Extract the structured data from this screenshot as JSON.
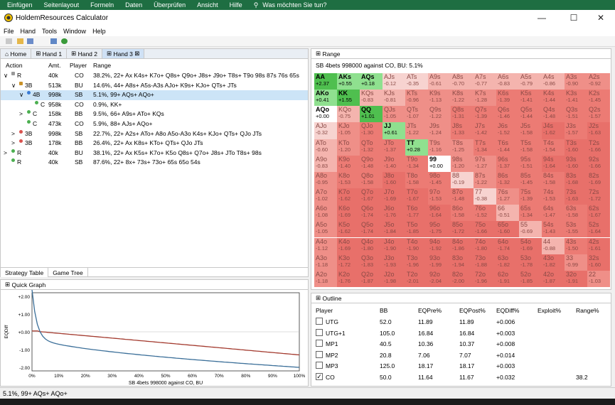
{
  "excel_menu": [
    "Einfügen",
    "Seitenlayout",
    "Formeln",
    "Daten",
    "Überprüfen",
    "Ansicht",
    "Hilfe",
    "Was möchten Sie tun?"
  ],
  "window": {
    "title": "HoldemResources Calculator",
    "min": "—",
    "max": "☐",
    "close": "✕"
  },
  "menu": [
    "File",
    "Hand",
    "Tools",
    "Window",
    "Help"
  ],
  "left_tabs": [
    "Home",
    "Hand 1",
    "Hand 2",
    "Hand 3"
  ],
  "tree": {
    "headers": [
      "Action",
      "Amt.",
      "Player",
      "Range"
    ],
    "rows": [
      {
        "indent": 0,
        "tog": "∨",
        "icon": "fold",
        "action": "R",
        "amt": "40k",
        "player": "CO",
        "range": "38.2%, 22+ Ax K4s+ K7o+ Q8s+ Q9o+ J8s+ J9o+ T8s+ T9o 98s 87s 76s 65s"
      },
      {
        "indent": 1,
        "tog": "∨",
        "icon": "lock",
        "action": "3B",
        "amt": "513k",
        "player": "BU",
        "range": "14.6%, 44+ A8s+ A5s-A3s AJo+ K9s+ KJo+ QTs+ JTs"
      },
      {
        "indent": 2,
        "tog": "∨",
        "icon": "blue",
        "action": "4B",
        "amt": "998k",
        "player": "SB",
        "range": "5.1%, 99+ AQs+ AQo+",
        "sel": true
      },
      {
        "indent": 3,
        "tog": "",
        "icon": "green",
        "action": "C",
        "amt": "958k",
        "player": "CO",
        "range": "0.9%, KK+"
      },
      {
        "indent": 2,
        "tog": ">",
        "icon": "green",
        "action": "C",
        "amt": "158k",
        "player": "BB",
        "range": "9.5%, 66+ A9s+ ATo+ KQs"
      },
      {
        "indent": 2,
        "tog": "",
        "icon": "green",
        "action": "C",
        "amt": "473k",
        "player": "CO",
        "range": "5.9%, 88+ AJs+ AQo+"
      },
      {
        "indent": 1,
        "tog": ">",
        "icon": "red",
        "action": "3B",
        "amt": "998k",
        "player": "SB",
        "range": "22.7%, 22+ A2s+ ATo+ A8o A5o-A3o K4s+ KJo+ QTs+ QJo JTs"
      },
      {
        "indent": 1,
        "tog": ">",
        "icon": "red",
        "action": "3B",
        "amt": "178k",
        "player": "BB",
        "range": "26.4%, 22+ Ax K8s+ KTo+ QTs+ QJo JTs"
      },
      {
        "indent": 0,
        "tog": ">",
        "icon": "green",
        "action": "R",
        "amt": "40k",
        "player": "BU",
        "range": "38.1%, 22+ Ax K5s+ K7o+ K5o Q8s+ Q7o+ J8s+ JTo T8s+ 98s"
      },
      {
        "indent": 0,
        "tog": "",
        "icon": "green",
        "action": "R",
        "amt": "40k",
        "player": "SB",
        "range": "87.6%, 22+ 8x+ 73s+ 73o+ 65s 65o 54s"
      }
    ]
  },
  "bottom_tabs": [
    "Strategy Table",
    "Game Tree"
  ],
  "range_panel": {
    "title": "Range",
    "info": "SB 4bets 998000 against CO, BU: 5.1%"
  },
  "grid": [
    [
      "AA",
      "+2.37",
      "AKs",
      "+0.55",
      "AQs",
      "+0.18",
      "AJs",
      "-0.12",
      "ATs",
      "-0.35",
      "A9s",
      "-0.61",
      "A8s",
      "-0.70",
      "A7s",
      "-0.77",
      "A6s",
      "-0.83",
      "A5s",
      "-0.79",
      "A4s",
      "-0.86",
      "A3s",
      "-0.90",
      "A2s",
      "-0.92"
    ],
    [
      "AKo",
      "+0.41",
      "KK",
      "+1.55",
      "KQs",
      "-0.83",
      "KJs",
      "-0.81",
      "KTs",
      "-0.96",
      "K9s",
      "-1.13",
      "K8s",
      "-1.22",
      "K7s",
      "-1.28",
      "K6s",
      "-1.39",
      "K5s",
      "-1.41",
      "K4s",
      "-1.44",
      "K3s",
      "-1.41",
      "K2s",
      "-1.45"
    ],
    [
      "AQo",
      "+0.00",
      "KQo",
      "-0.75",
      "QQ",
      "+1.01",
      "QJs",
      "-1.05",
      "QTs",
      "-1.07",
      "Q9s",
      "-1.22",
      "Q8s",
      "-1.31",
      "Q7s",
      "-1.39",
      "Q6s",
      "-1.46",
      "Q5s",
      "-1.44",
      "Q4s",
      "-1.48",
      "Q3s",
      "-1.51",
      "Q2s",
      "-1.57"
    ],
    [
      "AJo",
      "-0.32",
      "KJo",
      "-1.05",
      "QJo",
      "-1.30",
      "JJ",
      "+0.61",
      "JTs",
      "-1.22",
      "J9s",
      "-1.24",
      "J8s",
      "-1.33",
      "J7s",
      "-1.42",
      "J6s",
      "-1.52",
      "J5s",
      "-1.58",
      "J4s",
      "-1.62",
      "J3s",
      "-1.57",
      "J2s",
      "-1.63"
    ],
    [
      "ATo",
      "-0.60",
      "KTo",
      "-1.20",
      "QTo",
      "-1.32",
      "JTo",
      "-1.37",
      "TT",
      "+0.28",
      "T9s",
      "-1.16",
      "T8s",
      "-1.25",
      "T7s",
      "-1.34",
      "T6s",
      "-1.44",
      "T5s",
      "-1.58",
      "T4s",
      "-1.54",
      "T3s",
      "-1.60",
      "T2s",
      "-1.66"
    ],
    [
      "A9o",
      "-0.83",
      "K9o",
      "-1.40",
      "Q9o",
      "-1.48",
      "J9o",
      "-1.40",
      "T9o",
      "-1.34",
      "99",
      "+0.00",
      "98s",
      "-1.20",
      "97s",
      "-1.27",
      "96s",
      "-1.37",
      "95s",
      "-1.51",
      "94s",
      "-1.64",
      "93s",
      "-1.60",
      "92s",
      "-1.66"
    ],
    [
      "A8o",
      "-0.95",
      "K8o",
      "-1.53",
      "Q8o",
      "-1.58",
      "J8o",
      "-1.60",
      "T8o",
      "-1.58",
      "98o",
      "-1.45",
      "88",
      "-0.19",
      "87s",
      "-1.22",
      "86s",
      "-1.32",
      "85s",
      "-1.45",
      "84s",
      "-1.58",
      "83s",
      "-1.68",
      "82s",
      "-1.69"
    ],
    [
      "A7o",
      "-1.02",
      "K7o",
      "-1.62",
      "Q7o",
      "-1.67",
      "J7o",
      "-1.69",
      "T7o",
      "-1.67",
      "97o",
      "-1.53",
      "87o",
      "-1.48",
      "77",
      "-0.38",
      "76s",
      "-1.27",
      "75s",
      "-1.39",
      "74s",
      "-1.53",
      "73s",
      "-1.63",
      "72s",
      "-1.72"
    ],
    [
      "A6o",
      "-1.08",
      "K6o",
      "-1.69",
      "Q6o",
      "-1.74",
      "J6o",
      "-1.76",
      "T6o",
      "-1.77",
      "96o",
      "-1.64",
      "86o",
      "-1.58",
      "76o",
      "-1.52",
      "66",
      "-0.51",
      "65s",
      "-1.34",
      "64s",
      "-1.47",
      "63s",
      "-1.58",
      "62s",
      "-1.67"
    ],
    [
      "A5o",
      "-1.05",
      "K5o",
      "-1.62",
      "Q5o",
      "-1.74",
      "J5o",
      "-1.84",
      "T5o",
      "-1.85",
      "95o",
      "-1.75",
      "85o",
      "-1.72",
      "75o",
      "-1.66",
      "65o",
      "-1.60",
      "55",
      "-0.69",
      "54s",
      "-1.43",
      "53s",
      "-1.55",
      "52s",
      "-1.64"
    ],
    [
      "A4o",
      "-1.12",
      "K4o",
      "-1.69",
      "Q4o",
      "-1.80",
      "J4o",
      "-1.90",
      "T4o",
      "-1.90",
      "94o",
      "-1.92",
      "84o",
      "-1.86",
      "74o",
      "-1.80",
      "64o",
      "-1.74",
      "54o",
      "-1.69",
      "44",
      "-0.88",
      "43s",
      "-1.50",
      "42s",
      "-1.61"
    ],
    [
      "A3o",
      "-1.18",
      "K3o",
      "-1.72",
      "Q3o",
      "-1.83",
      "J3o",
      "-1.93",
      "T3o",
      "-1.96",
      "93o",
      "-1.99",
      "83o",
      "-1.94",
      "73o",
      "-1.88",
      "63o",
      "-1.82",
      "53o",
      "-1.78",
      "43o",
      "-1.82",
      "33",
      "-0.99",
      "32s",
      "-1.60"
    ],
    [
      "A2o",
      "-1.18",
      "K2o",
      "-1.76",
      "Q2o",
      "-1.87",
      "J2o",
      "-1.98",
      "T2o",
      "-2.01",
      "92o",
      "-2.04",
      "82o",
      "-2.00",
      "72o",
      "-1.96",
      "62o",
      "-1.91",
      "52o",
      "-1.85",
      "42o",
      "-1.87",
      "32o",
      "-1.91",
      "22",
      "-1.03"
    ]
  ],
  "quick_graph": {
    "title": "Quick Graph",
    "xlabel": "SB 4bets 998000 against CO, BU",
    "ylabel": "EQDiff",
    "yticks": [
      "+2.00",
      "+1.00",
      "+0.00",
      "-1.00",
      "-2.00"
    ],
    "xticks": [
      "0%",
      "10%",
      "20%",
      "30%",
      "40%",
      "50%",
      "60%",
      "70%",
      "80%",
      "90%",
      "100%"
    ]
  },
  "outline": {
    "title": "Outline",
    "headers": [
      "Player",
      "BB",
      "EQPre%",
      "EQPost%",
      "EQDiff%",
      "Exploit%",
      "Range%"
    ],
    "rows": [
      {
        "p": "UTG",
        "bb": "52.0",
        "pre": "11.89",
        "post": "11.89",
        "diff": "+0.006",
        "ex": "",
        "rg": "",
        "chk": false
      },
      {
        "p": "UTG+1",
        "bb": "105.0",
        "pre": "16.84",
        "post": "16.84",
        "diff": "+0.003",
        "ex": "",
        "rg": "",
        "chk": false
      },
      {
        "p": "MP1",
        "bb": "40.5",
        "pre": "10.36",
        "post": "10.37",
        "diff": "+0.008",
        "ex": "",
        "rg": "",
        "chk": false
      },
      {
        "p": "MP2",
        "bb": "20.8",
        "pre": "7.06",
        "post": "7.07",
        "diff": "+0.014",
        "ex": "",
        "rg": "",
        "chk": false
      },
      {
        "p": "MP3",
        "bb": "125.0",
        "pre": "18.17",
        "post": "18.17",
        "diff": "+0.003",
        "ex": "",
        "rg": "",
        "chk": false
      },
      {
        "p": "CO",
        "bb": "50.0",
        "pre": "11.64",
        "post": "11.67",
        "diff": "+0.032",
        "ex": "",
        "rg": "38.2",
        "chk": true
      }
    ]
  },
  "status": "5.1%, 99+ AQs+ AQo+"
}
